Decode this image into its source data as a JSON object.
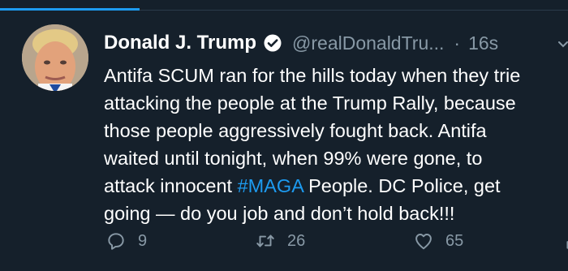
{
  "tweet": {
    "author": {
      "name": "Donald J. Trump",
      "handle": "@realDonaldTru...",
      "verified": true,
      "avatar_icon": "avatar-photo"
    },
    "separator": "·",
    "time": "16s",
    "text_lines": [
      "Antifa SCUM ran for the hills today when they trie",
      "attacking the people at the Trump Rally, because",
      "those people aggressively fought back. Antifa",
      "waited until tonight, when 99% were gone, to",
      "attack innocent",
      "#MAGA",
      "People. DC Police, get",
      "going — do you job and don’t hold back!!!"
    ],
    "actions": {
      "replies": "9",
      "retweets": "26",
      "likes": "65"
    }
  },
  "colors": {
    "background": "#15202b",
    "text": "#ffffff",
    "secondary_text": "#8899a6",
    "accent": "#1d9bf0"
  },
  "icons": {
    "reply": "reply-icon",
    "retweet": "retweet-icon",
    "like": "heart-icon",
    "share": "share-icon",
    "verified": "verified-badge-icon",
    "more": "chevron-down-icon"
  }
}
